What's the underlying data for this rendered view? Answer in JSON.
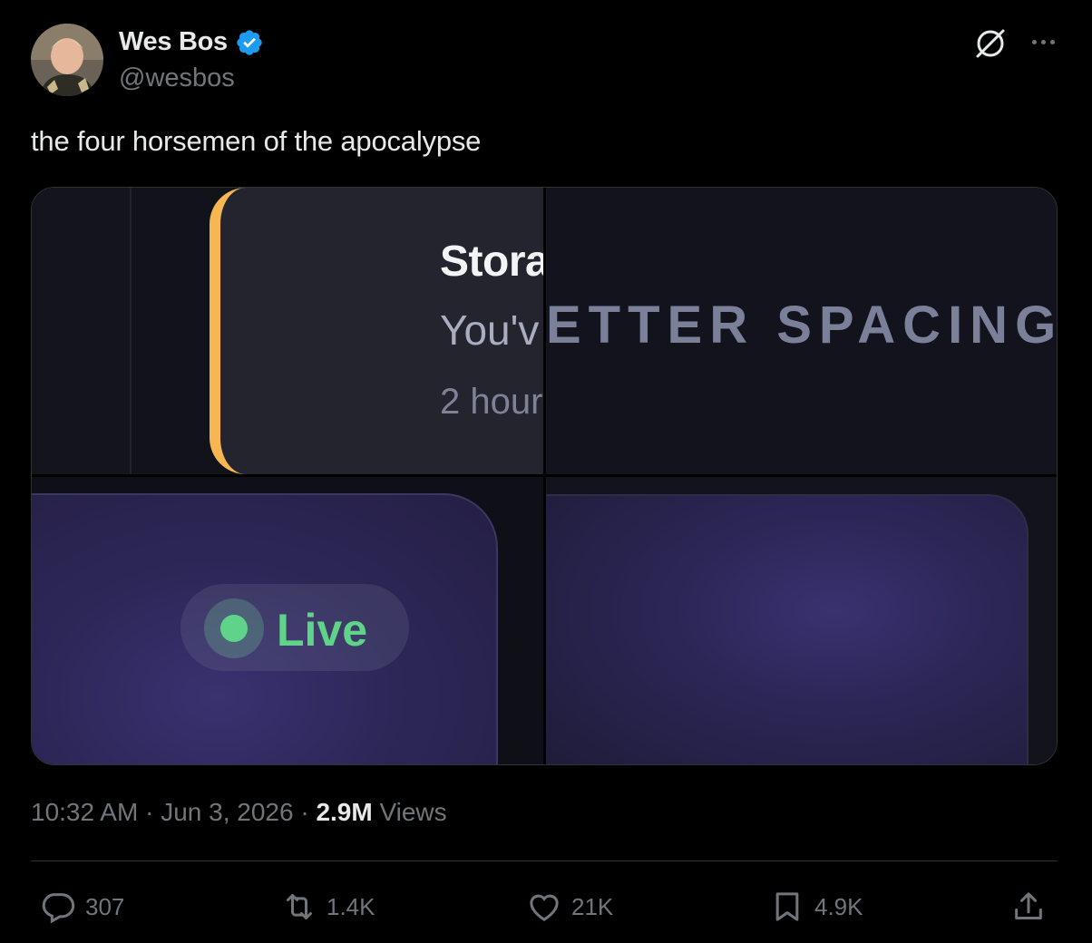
{
  "author": {
    "name": "Wes Bos",
    "handle": "@wesbos",
    "verified": true,
    "avatar_icon": "avatar"
  },
  "tweet": {
    "text": "the four horsemen of the apocalypse"
  },
  "media": {
    "notification": {
      "title": "Stora",
      "body": "You'v",
      "time": "2 hour"
    },
    "spacing_text": "ETTER SPACING",
    "live_badge": "Live"
  },
  "meta": {
    "time": "10:32 AM",
    "separator": " · ",
    "date": "Jun 3, 2026",
    "views_count": "2.9M",
    "views_label": "Views"
  },
  "actions": {
    "replies": "307",
    "reposts": "1.4K",
    "likes": "21K",
    "bookmarks": "4.9K"
  },
  "colors": {
    "accent_verified": "#1d9bf0",
    "live_green": "#5fd38a",
    "notif_border": "#f6b651"
  }
}
